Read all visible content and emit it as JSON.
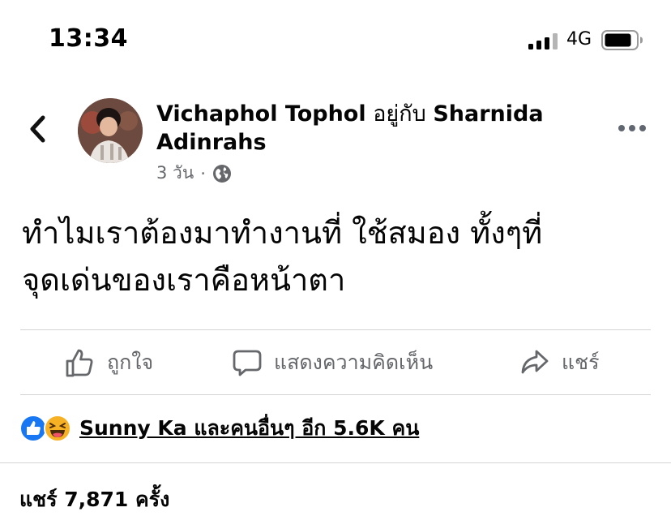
{
  "status_bar": {
    "time": "13:34",
    "network": "4G",
    "signal_icon": "cellular-signal-icon",
    "battery_icon": "battery-icon"
  },
  "post": {
    "author": "Vichaphol Tophol",
    "with_word": "อยู่กับ",
    "tagged": "Sharnida Adinrahs",
    "timestamp": "3 วัน",
    "audience_icon": "globe-icon",
    "text_line1": "ทำไมเราต้องมาทำงานที่ ใช้สมอง ทั้งๆที่",
    "text_line2": "จุดเด่นของเราคือหน้าตา"
  },
  "actions": {
    "like_label": "ถูกใจ",
    "comment_label": "แสดงความคิดเห็น",
    "share_label": "แชร์"
  },
  "reactions": {
    "summary": "Sunny Ka และคนอื่นๆ อีก 5.6K คน",
    "icons": [
      "like-reaction-icon",
      "haha-reaction-icon"
    ]
  },
  "shares": {
    "summary": "แชร์ 7,871 ครั้ง"
  },
  "colors": {
    "text_primary": "#050505",
    "text_secondary": "#65676b",
    "like_blue": "#1877f2",
    "haha_yellow": "#f7b125",
    "divider": "#d4d4d4"
  }
}
